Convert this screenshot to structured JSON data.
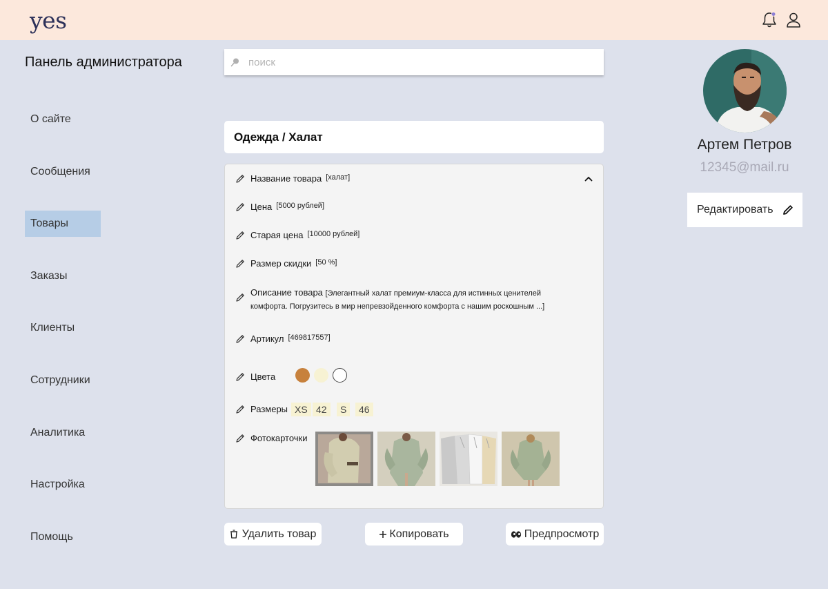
{
  "header": {
    "logo": "yes",
    "icons": [
      "bell-icon",
      "user-icon"
    ]
  },
  "sidebar": {
    "title": "Панель администратора",
    "items": [
      {
        "label": "О сайте"
      },
      {
        "label": "Сообщения"
      },
      {
        "label": "Товары",
        "active": true
      },
      {
        "label": "Заказы"
      },
      {
        "label": "Клиенты"
      },
      {
        "label": "Сотрудники"
      },
      {
        "label": "Аналитика"
      },
      {
        "label": "Настройка"
      },
      {
        "label": "Помощь"
      }
    ]
  },
  "search": {
    "placeholder": "поиск"
  },
  "breadcrumb": "Одежда / Халат",
  "product": {
    "name_label": "Название товара",
    "name_value": "[халат]",
    "price_label": "Цена",
    "price_value": "[5000 рублей]",
    "old_price_label": "Старая цена",
    "old_price_value": "[10000 рублей]",
    "discount_label": "Размер скидки",
    "discount_value": "[50 %]",
    "description_label": "Описание товара",
    "description_value": "[Элегантный халат премиум-класса для истинных ценителей комфорта. Погрузитесь в мир непревзойденного комфорта с нашим роскошным ...]",
    "sku_label": "Артикул",
    "sku_value": "[469817557]",
    "colors_label": "Цвета",
    "colors": [
      "#c7813c",
      "#f7f2d3",
      "#ffffff"
    ],
    "sizes_label": "Размеры",
    "sizes": [
      "XS",
      "42",
      "S",
      "46"
    ],
    "photos_label": "Фотокарточки"
  },
  "actions": {
    "delete": "Удалить товар",
    "copy": "Копировать",
    "preview": "Предпросмотр"
  },
  "profile": {
    "name": "Артем Петров",
    "email": "12345@mail.ru",
    "edit_label": "Редактировать"
  },
  "colors": {
    "topbar": "#fce8dc",
    "background": "#dde1ec",
    "active_nav": "#b6cde6",
    "logo": "#2d3159"
  }
}
